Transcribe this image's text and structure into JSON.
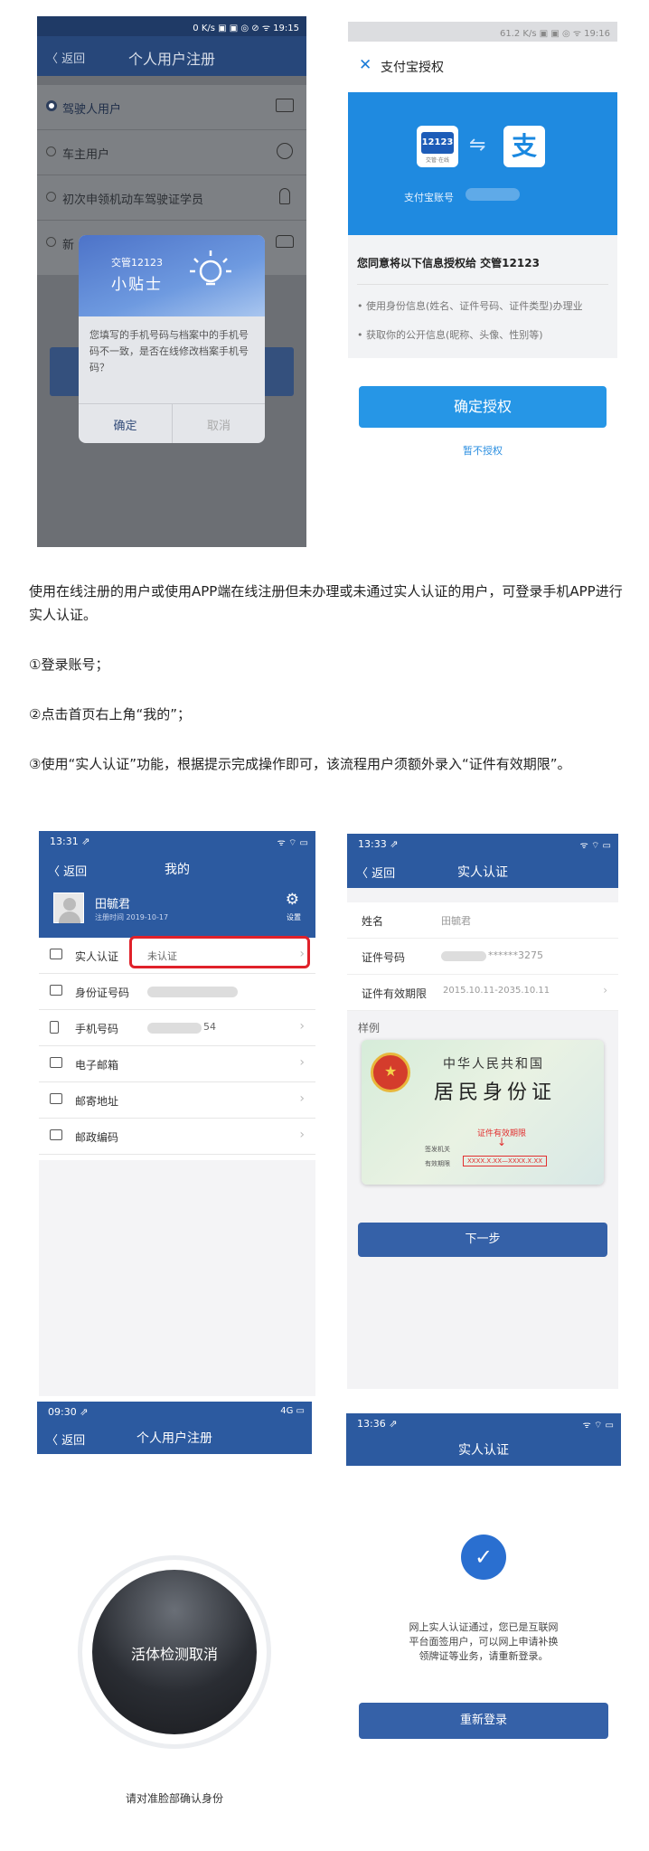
{
  "s1": {
    "status_right": "0 K/s ▣ ▣ ◎ ⊘ ᯤ 19:15",
    "back": "〈 返回",
    "title": "个人用户注册",
    "options": [
      "驾驶人用户",
      "车主用户",
      "初次申领机动车驾驶证学员"
    ],
    "option4_partial": "新",
    "dialog_brand": "交管12123",
    "dialog_title": "小贴士",
    "dialog_msg": "您填写的手机号码与档案中的手机号码不一致，是否在线修改档案手机号码？",
    "dialog_ok": "确定",
    "dialog_cancel": "取消"
  },
  "s2": {
    "status_right": "61.2 K/s ▣ ▣ ◎ ᯤ 19:16",
    "close": "✕",
    "title": "支付宝授权",
    "app_logo": "12123",
    "app_logo_sub": "交管·在线",
    "ali_logo": "支",
    "account_label": "支付宝账号",
    "consent": "您同意将以下信息授权给 交管12123",
    "item1": "• 使用身份信息(姓名、证件号码、证件类型)办理业",
    "item2": "• 获取你的公开信息(昵称、头像、性别等)",
    "confirm": "确定授权",
    "decline": "暂不授权"
  },
  "text": {
    "p1": "使用在线注册的用户或使用APP端在线注册但未办理或未通过实人认证的用户，可登录手机APP进行实人认证。",
    "p2": "①登录账号；",
    "p3": "②点击首页右上角“我的”；",
    "p4": "③使用“实人认证”功能，根据提示完成操作即可，该流程用户须额外录入“证件有效期限”。"
  },
  "s3": {
    "time": "13:31 ⇗",
    "status_right": "ᯤ ⌔ ▭",
    "back": "〈 返回",
    "title": "我的",
    "username": "田毓君",
    "reg_time": "注册时间 2019-10-17",
    "settings": "设置",
    "rows": [
      {
        "label": "实人认证",
        "value": "未认证"
      },
      {
        "label": "身份证号码",
        "value": ""
      },
      {
        "label": "手机号码",
        "value": "54"
      },
      {
        "label": "电子邮箱",
        "value": ""
      },
      {
        "label": "邮寄地址",
        "value": ""
      },
      {
        "label": "邮政编码",
        "value": ""
      }
    ]
  },
  "s4": {
    "time": "13:33 ⇗",
    "back": "〈 返回",
    "title": "实人认证",
    "name_label": "姓名",
    "name_value": "田毓君",
    "id_label": "证件号码",
    "id_value": "******3275",
    "valid_label": "证件有效期限",
    "valid_value": "2015.10.11-2035.10.11",
    "sample": "样例",
    "card_title1": "中华人民共和国",
    "card_title2": "居民身份证",
    "card_note": "证件有效期限",
    "card_issuer": "签发机关",
    "card_valid": "有效期限",
    "card_valid_value": "XXXX.X.XX—XXXX.X.XX",
    "next": "下一步"
  },
  "s5": {
    "time": "09:30 ⇗",
    "status_right": "4G ▭",
    "back": "〈 返回",
    "title": "个人用户注册",
    "liveness": "活体检测取消",
    "hint": "请对准脸部确认身份"
  },
  "s6": {
    "time": "13:36 ⇗",
    "title": "实人认证",
    "check": "✓",
    "msg1": "网上实人认证通过，您已是互联网",
    "msg2": "平台面签用户，可以网上申请补换",
    "msg3": "领牌证等业务，请重新登录。",
    "relogin": "重新登录"
  }
}
